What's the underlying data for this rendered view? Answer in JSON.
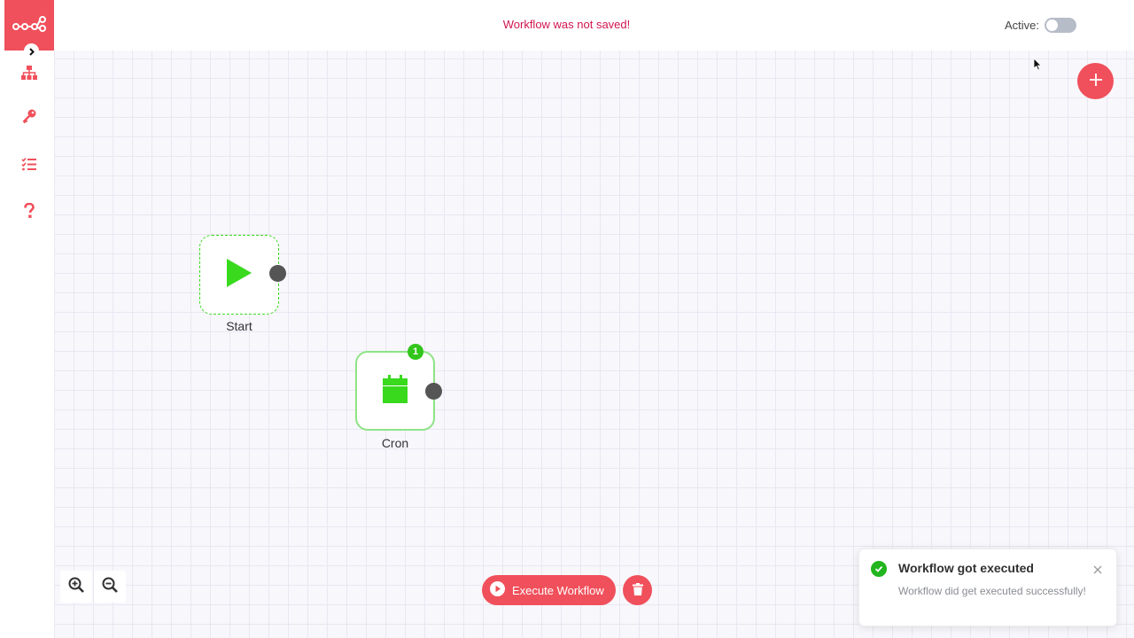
{
  "topbar": {
    "status_message": "Workflow was not saved!",
    "active_label": "Active:",
    "active_on": false
  },
  "sidebar": {
    "logo_icon": "n8n-logo-icon",
    "expand_icon": "chevron-right-icon",
    "items": [
      {
        "icon": "workflows-sitemap-icon"
      },
      {
        "icon": "credentials-key-icon"
      },
      {
        "icon": "executions-list-icon"
      },
      {
        "icon": "help-question-icon"
      }
    ]
  },
  "canvas": {
    "add_node_icon": "plus-icon",
    "nodes": [
      {
        "label": "Start",
        "icon": "play-icon"
      },
      {
        "label": "Cron",
        "icon": "calendar-icon",
        "badge": "1"
      }
    ],
    "zoom_in_icon": "zoom-in-icon",
    "zoom_out_icon": "zoom-out-icon"
  },
  "footer": {
    "execute_label": "Execute Workflow",
    "execute_icon": "play-circle-icon",
    "delete_icon": "trash-icon"
  },
  "toast": {
    "title": "Workflow got executed",
    "message": "Workflow did get executed successfully!",
    "status_icon": "check-circle-icon",
    "close_icon": "close-icon"
  },
  "colors": {
    "accent": "#f0505b",
    "status_text": "#d0154f",
    "node_green": "#39d91e",
    "success": "#22b51e"
  }
}
